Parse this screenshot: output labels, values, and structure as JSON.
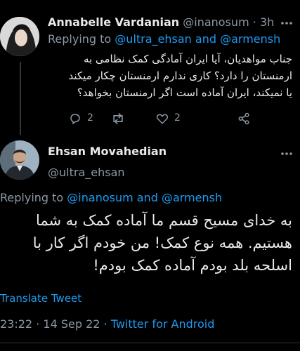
{
  "reply_tweet": {
    "author_name": "Annabelle Vardanian",
    "handle": "@inanosum",
    "separator": "·",
    "time": "3h",
    "replying_prefix": "Replying to",
    "replying_user_1": "@ultra_ehsan",
    "replying_and": "and",
    "replying_user_2": "@armensh",
    "text_lines": [
      "جناب مواهدیان، آیا ایران آمادگی کمک نظامی به",
      "ارمنستان را دارد؟ کاری ندارم ارمنستان چکار میکند",
      "یا نمیکند، ایران آماده است اگر ارمنستان بخواهد؟"
    ],
    "reply_count": "2",
    "like_count": "2"
  },
  "main_tweet": {
    "author_name": "Ehsan Movahedian",
    "handle": "@ultra_ehsan",
    "replying_prefix": "Replying to",
    "replying_user_1": "@inanosum",
    "replying_and": "and",
    "replying_user_2": "@armensh",
    "text_lines": [
      "به خدای مسیح قسم ما آماده کمک به شما",
      "هستیم. همه نوع کمک! من خودم اگر کار با",
      "اسلحه بلد بودم آماده کمک بودم!"
    ],
    "translate_label": "Translate Tweet",
    "time": "23:22",
    "dot": "·",
    "date": "14 Sep 22",
    "dot2": "·",
    "source": "Twitter for Android"
  },
  "colors": {
    "accent": "#1d9bf0",
    "muted": "#8b98a5",
    "background": "#000000"
  }
}
